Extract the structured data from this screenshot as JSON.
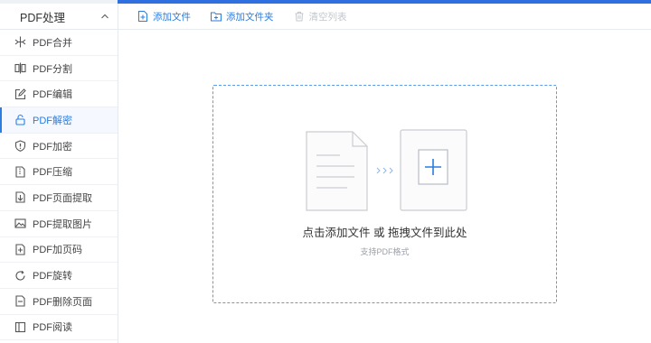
{
  "sidebar": {
    "header": "PDF处理",
    "items": [
      {
        "label": "PDF合并",
        "icon": "merge-icon"
      },
      {
        "label": "PDF分割",
        "icon": "split-icon"
      },
      {
        "label": "PDF编辑",
        "icon": "edit-icon"
      },
      {
        "label": "PDF解密",
        "icon": "unlock-icon",
        "active": true
      },
      {
        "label": "PDF加密",
        "icon": "shield-icon"
      },
      {
        "label": "PDF压缩",
        "icon": "compress-icon"
      },
      {
        "label": "PDF页面提取",
        "icon": "extract-page-icon"
      },
      {
        "label": "PDF提取图片",
        "icon": "image-icon"
      },
      {
        "label": "PDF加页码",
        "icon": "page-number-icon"
      },
      {
        "label": "PDF旋转",
        "icon": "rotate-icon"
      },
      {
        "label": "PDF删除页面",
        "icon": "delete-page-icon"
      },
      {
        "label": "PDF阅读",
        "icon": "book-icon"
      }
    ]
  },
  "toolbar": {
    "add_file": "添加文件",
    "add_folder": "添加文件夹",
    "clear_list": "清空列表"
  },
  "dropzone": {
    "main_text": "点击添加文件 或 拖拽文件到此处",
    "sub_text": "支持PDF格式"
  },
  "colors": {
    "accent": "#2b7de0",
    "top_bar": "#2f6fe0",
    "dashed_border": "#5b9ae8",
    "disabled": "#c3c7cd"
  }
}
